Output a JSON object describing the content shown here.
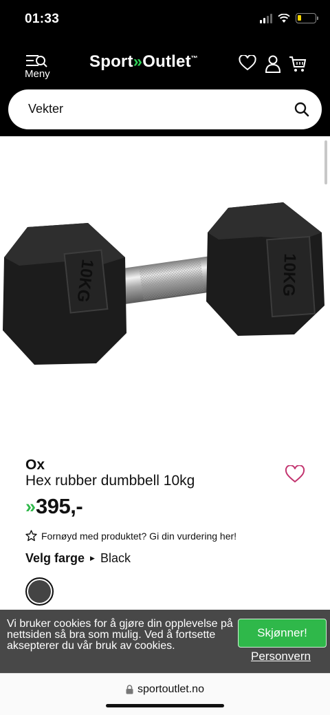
{
  "status": {
    "time": "01:33",
    "battery_level": 0.2,
    "battery_color": "#f5d400"
  },
  "header": {
    "menu_label": "Meny",
    "logo": {
      "word1": "Sport",
      "arrows": "»",
      "word2": "Outlet",
      "trademark": "™"
    },
    "icons": [
      "menu-icon",
      "heart-icon",
      "user-icon",
      "cart-icon"
    ]
  },
  "search": {
    "value": "Vekter",
    "icon": "search-icon"
  },
  "product": {
    "image": "dumbbell-photo",
    "plate_text": "10KG",
    "brand": "Ox",
    "name": "Hex rubber dumbbell 10kg",
    "price_arrows": "»",
    "price": "395,-",
    "review_prompt": "Fornøyd med produktet? Gi din vurdering her!",
    "color_label": "Velg farge",
    "color_value": "Black",
    "swatch_color": "#444444"
  },
  "cookie": {
    "text": "Vi bruker cookies for å gjøre din opplevelse på nettsiden så bra som mulig. Ved å fortsette aksepterer du vår bruk av cookies.",
    "accept_label": "Skjønner!",
    "privacy_label": "Personvern"
  },
  "browser": {
    "url": "sportoutlet.no"
  },
  "colors": {
    "brand_green": "#2fb84a",
    "header_bg": "#000000",
    "wishlist_pink": "#c2336e"
  }
}
